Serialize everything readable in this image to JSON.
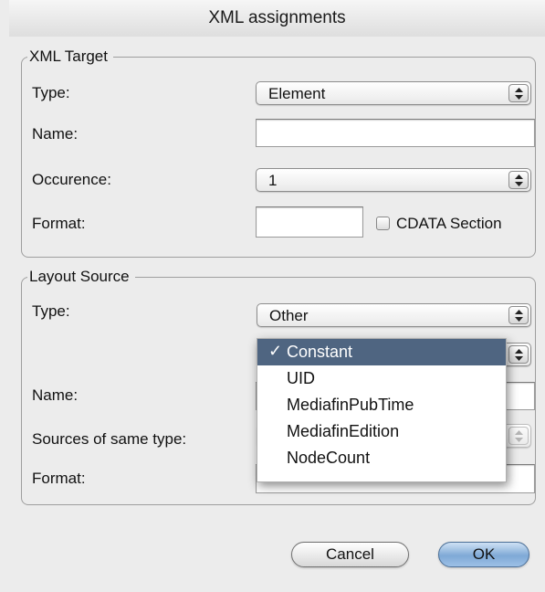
{
  "window": {
    "title": "XML assignments"
  },
  "xml_target": {
    "legend": "XML Target",
    "type_label": "Type:",
    "type_value": "Element",
    "name_label": "Name:",
    "name_value": "",
    "occurence_label": "Occurence:",
    "occurence_value": "1",
    "format_label": "Format:",
    "format_value": "",
    "cdata_label": "CDATA Section",
    "cdata_checked": false
  },
  "layout_source": {
    "legend": "Layout Source",
    "type_label": "Type:",
    "type_value": "Other",
    "name_label": "Name:",
    "name_value": "",
    "sources_label": "Sources of same type:",
    "format_label": "Format:",
    "format_value": ""
  },
  "dropdown_menu": {
    "check_mark": "✓",
    "items": [
      {
        "label": "Constant",
        "selected": true
      },
      {
        "label": "UID",
        "selected": false
      },
      {
        "label": "MediafinPubTime",
        "selected": false
      },
      {
        "label": "MediafinEdition",
        "selected": false
      },
      {
        "label": "NodeCount",
        "selected": false
      }
    ]
  },
  "buttons": {
    "cancel": "Cancel",
    "ok": "OK"
  },
  "colors": {
    "menu_highlight": "#4f6581",
    "default_button": "#7fa9d6"
  }
}
